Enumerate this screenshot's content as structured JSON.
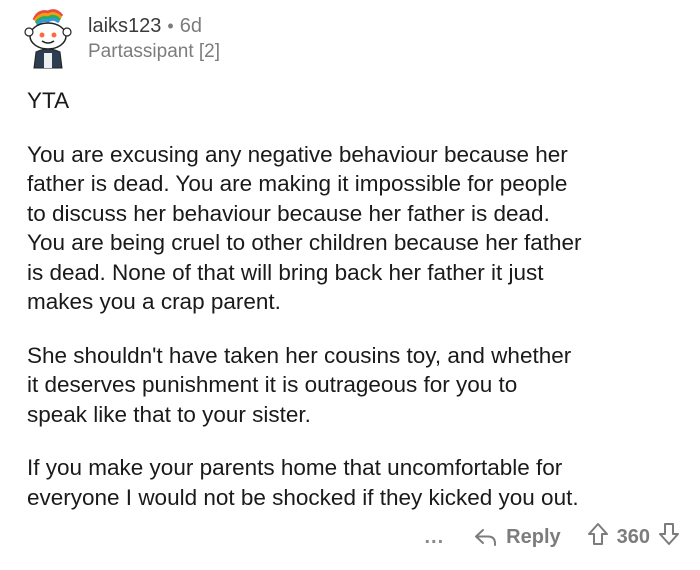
{
  "author": {
    "username": "laiks123",
    "age": "6d",
    "separator": "•",
    "flair": "Partassipant [2]"
  },
  "comment": {
    "verdict": "YTA",
    "paragraphs": [
      "You are excusing any negative behaviour because her\nfather is dead.  You are making it impossible for people\nto discuss her behaviour because her father is dead.\nYou are being cruel to other children because her father\nis dead.  None of that will bring back her father it just\nmakes you a crap parent.",
      "She shouldn't have taken her cousins toy, and whether\nit deserves punishment it is outrageous for you to\nspeak like that to your sister.",
      "If you make your parents home that uncomfortable for\neveryone I would not be shocked if they kicked you out."
    ]
  },
  "actions": {
    "more_label": "...",
    "reply_label": "Reply",
    "vote_count": "360",
    "icons": {
      "more": "more-options-icon",
      "reply": "reply-arrow-icon",
      "upvote": "upvote-arrow-icon",
      "downvote": "downvote-arrow-icon"
    }
  },
  "colors": {
    "text": "#1a1a1b",
    "muted": "#7c7c7c"
  }
}
